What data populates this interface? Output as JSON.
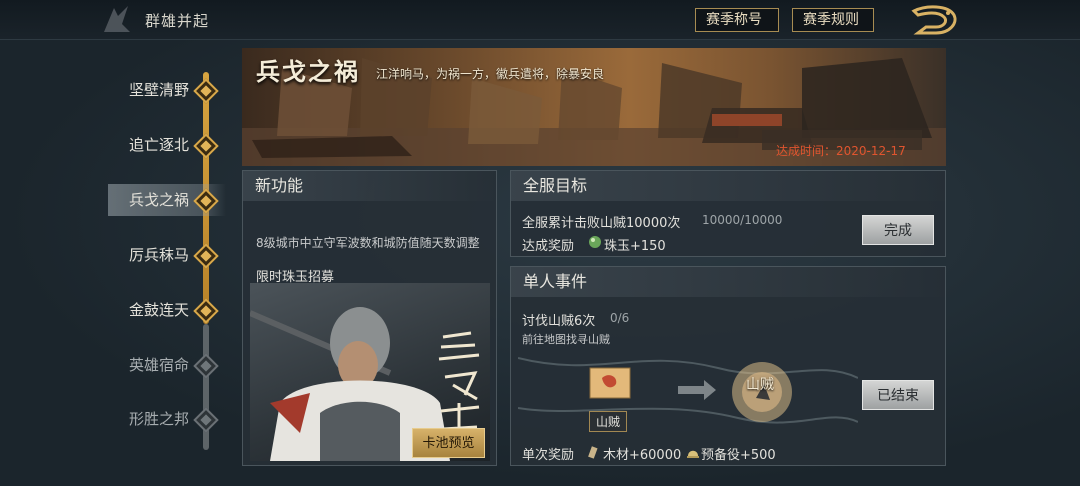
{
  "header": {
    "title": "群雄并起",
    "season_title_btn": "赛季称号",
    "season_rules_btn": "赛季规则"
  },
  "timeline": {
    "items": [
      {
        "label": "坚壁清野",
        "state": "done"
      },
      {
        "label": "追亡逐北",
        "state": "done"
      },
      {
        "label": "兵戈之祸",
        "state": "active"
      },
      {
        "label": "厉兵秣马",
        "state": "done"
      },
      {
        "label": "金鼓连天",
        "state": "done"
      },
      {
        "label": "英雄宿命",
        "state": "future"
      },
      {
        "label": "形胜之邦",
        "state": "future"
      }
    ]
  },
  "banner": {
    "title": "兵戈之祸",
    "subtitle": "江洋响马，为祸一方，徽兵遣将，除暴安良",
    "date": "达成时间：2020-12-17"
  },
  "new_feature": {
    "heading": "新功能",
    "desc": "8级城市中立守军波数和城防值随天数调整",
    "recruit_label": "限时珠玉招募",
    "calligraphy": "三足鼎立",
    "pool_btn": "卡池预览"
  },
  "server_goal": {
    "heading": "全服目标",
    "task": "全服累计击败山贼10000次",
    "progress": "10000/10000",
    "reward_label": "达成奖励",
    "reward_item": "珠玉+150",
    "button": "完成"
  },
  "single_event": {
    "heading": "单人事件",
    "task": "讨伐山贼6次",
    "progress": "0/6",
    "hint": "前往地图找寻山贼",
    "map_tag": "山贼",
    "target_label": "山贼",
    "button": "已结束",
    "reward_label": "单次奖励",
    "reward_wood": "木材+60000",
    "reward_reserve": "预备役+500"
  },
  "colors": {
    "gold": "#d7a440",
    "date_red": "#e0552f"
  }
}
